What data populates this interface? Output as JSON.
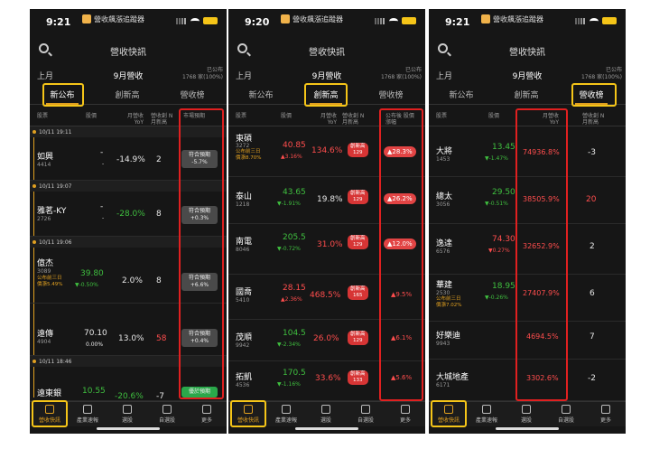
{
  "common": {
    "app_name": "營收飆漲追蹤器",
    "screen_title": "營收快訊",
    "period_left": "上月",
    "period_mid": "9月營收",
    "published_label": "已公布",
    "published_count": "1768 家(100%)",
    "tabs": [
      "新公布",
      "創新高",
      "營收榜"
    ],
    "nav": [
      "營收快訊",
      "產業速報",
      "選股",
      "自選股",
      "更多"
    ]
  },
  "screens": [
    {
      "time": "9:21",
      "columns": [
        "股票",
        "股價",
        "月營收 YoY",
        "營收創 N月新高",
        "市場預期"
      ],
      "timebars": [
        "10/11 19:11",
        "10/11 19:07",
        "10/11 19:06",
        "10/11 18:46"
      ],
      "rows": [
        {
          "name": "如興",
          "code": "4414",
          "price": "-",
          "change": "-",
          "yoy": "-14.9%",
          "n": "2",
          "exp1": "符合預期",
          "exp2": "-5.7%"
        },
        {
          "name": "雅茗-KY",
          "code": "2726",
          "price": "-",
          "change": "-",
          "yoy": "-28.0%",
          "n": "8",
          "exp1": "符合預期",
          "exp2": "+0.3%"
        },
        {
          "name": "億杰",
          "code": "3089",
          "note1": "公布前三日",
          "note2": "價漲5.49%",
          "price": "39.80",
          "change": "▼-0.50%",
          "yoy": "2.0%",
          "n": "8",
          "exp1": "符合預期",
          "exp2": "+6.6%"
        },
        {
          "name": "遠傳",
          "code": "4904",
          "price": "70.10",
          "change": "0.00%",
          "yoy": "13.0%",
          "n": "58",
          "exp1": "符合預期",
          "exp2": "+0.4%"
        },
        {
          "name": "遠東銀",
          "code": "",
          "price": "10.55",
          "change": "",
          "yoy": "-20.6%",
          "n": "-7",
          "exp1": "優於預期",
          "exp2": ""
        }
      ]
    },
    {
      "time": "9:20",
      "columns": [
        "股票",
        "股價",
        "月營收 YoY",
        "營收創 N月新高",
        "公布後 股價漲幅"
      ],
      "rows": [
        {
          "name": "東碩",
          "code": "3272",
          "note1": "公布前三日",
          "note2": "價漲8.70%",
          "price": "40.85",
          "change": "▲3.16%",
          "yoy": "134.6%",
          "badge1": "創新高",
          "badge2": "129",
          "gain": "▲28.3%"
        },
        {
          "name": "泰山",
          "code": "1218",
          "price": "43.65",
          "change": "▼-1.91%",
          "yoy": "19.8%",
          "badge1": "創新高",
          "badge2": "129",
          "gain": "▲26.2%"
        },
        {
          "name": "南電",
          "code": "8046",
          "price": "205.5",
          "change": "▼-0.72%",
          "yoy": "31.0%",
          "badge1": "創新高",
          "badge2": "129",
          "gain": "▲12.0%"
        },
        {
          "name": "國喬",
          "code": "5410",
          "price": "28.15",
          "change": "▲2.36%",
          "yoy": "468.5%",
          "badge1": "創新高",
          "badge2": "165",
          "gain": "▲9.5%"
        },
        {
          "name": "茂順",
          "code": "9942",
          "price": "104.5",
          "change": "▼-2.34%",
          "yoy": "26.0%",
          "badge1": "創新高",
          "badge2": "129",
          "gain": "▲6.1%"
        },
        {
          "name": "拓凱",
          "code": "4536",
          "price": "170.5",
          "change": "▼-1.16%",
          "yoy": "33.6%",
          "badge1": "創新高",
          "badge2": "133",
          "gain": "▲5.6%"
        }
      ]
    },
    {
      "time": "9:21",
      "columns": [
        "股票",
        "股價",
        "月營收 YoY",
        "營收創 N月新高"
      ],
      "rows": [
        {
          "name": "大將",
          "code": "1453",
          "price": "13.45",
          "change": "▼-1.47%",
          "yoy": "74936.8%",
          "n": "-3"
        },
        {
          "name": "總太",
          "code": "3056",
          "price": "29.50",
          "change": "▼-0.51%",
          "yoy": "38505.9%",
          "n": "20"
        },
        {
          "name": "逸達",
          "code": "6576",
          "price": "74.30",
          "change": "▼0.27%",
          "yoy": "32652.9%",
          "n": "2"
        },
        {
          "name": "華建",
          "code": "2530",
          "note1": "公布前三日",
          "note2": "價漲7.02%",
          "price": "18.95",
          "change": "▼-0.26%",
          "yoy": "27407.9%",
          "n": "6"
        },
        {
          "name": "好樂迪",
          "code": "9943",
          "price": "",
          "change": "",
          "yoy": "4694.5%",
          "n": "7"
        },
        {
          "name": "大城地產",
          "code": "6171",
          "price": "",
          "change": "",
          "yoy": "3302.6%",
          "n": "-2"
        }
      ]
    }
  ]
}
